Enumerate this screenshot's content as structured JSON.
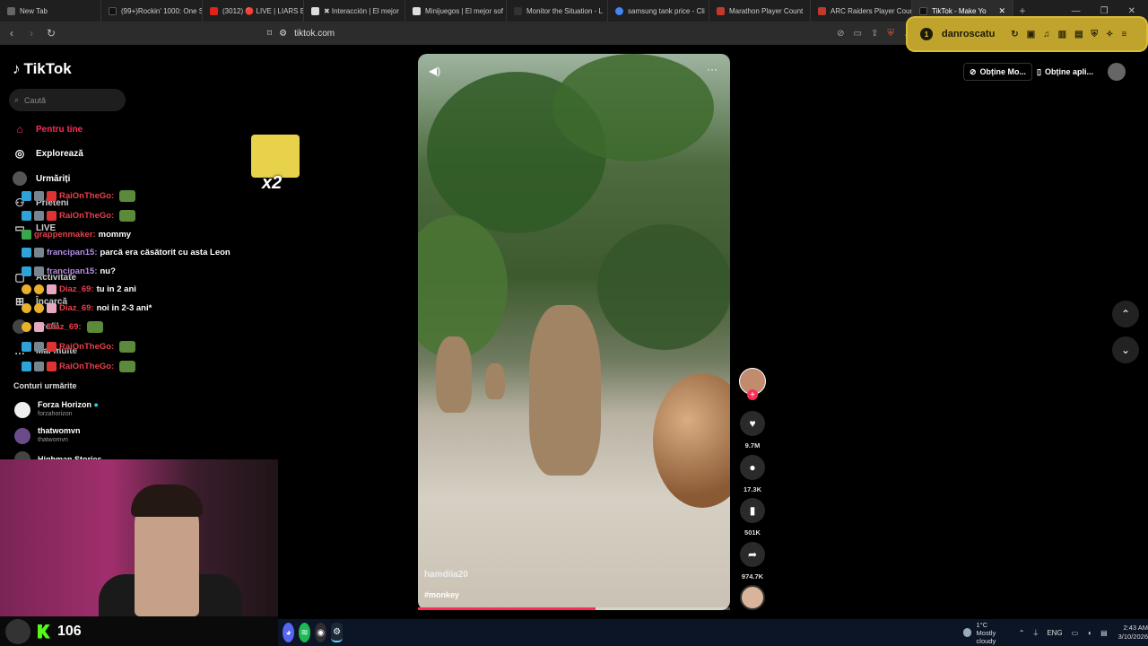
{
  "browser": {
    "tabs": [
      {
        "title": "New Tab",
        "color": "#666"
      },
      {
        "title": "(99+)Rockin' 1000: One S",
        "color": "#111"
      },
      {
        "title": "(3012) 🔴 LIVE | LIARS BA",
        "color": "#e62117"
      },
      {
        "title": "✖ Interacción | El mejor",
        "color": "#222"
      },
      {
        "title": "Minijuegos | El mejor sof",
        "color": "#222"
      },
      {
        "title": "Monitor the Situation - L",
        "color": "#333"
      },
      {
        "title": "samsung tank price - Cli",
        "color": "#4285f4"
      },
      {
        "title": "Marathon Player Count",
        "color": "#c0392b"
      },
      {
        "title": "ARC Raiders Player Coun",
        "color": "#c0392b"
      },
      {
        "title": "TikTok - Make Yo",
        "color": "#111",
        "active": true
      }
    ],
    "new_tab_label": "+",
    "url": "tiktok.com",
    "profile_name": "danroscatu",
    "profile_badge": "1"
  },
  "tiktok": {
    "logo": "TikTok",
    "search_placeholder": "Caută",
    "nav": {
      "fyp": "Pentru tine",
      "explore": "Explorează",
      "following": "Urmăriți",
      "friends": "Prieteni",
      "live": "LIVE",
      "activity": "Activitate",
      "upload": "Încarcă",
      "profile": "Profil",
      "more": "Mai multe"
    },
    "following_accounts_title": "Conturi urmărite",
    "accounts": [
      {
        "name": "Forza Horizon",
        "handle": "forzahorizon",
        "verified": true
      },
      {
        "name": "thatwomvn",
        "handle": "thatwomvn",
        "verified": false
      },
      {
        "name": "Highman.Stories",
        "handle": "",
        "verified": false
      }
    ],
    "top_buttons": {
      "get_coins": "Obține Mo...",
      "get_app": "Obține apli..."
    },
    "video": {
      "author": "hamdiia20",
      "hashtag": "#monkey",
      "progress_fraction": 0.57
    },
    "actions": {
      "likes": "9.7M",
      "comments": "17.3K",
      "saves": "501K",
      "shares": "974.7K"
    }
  },
  "chat": [
    {
      "user": "RaiOnTheGo:",
      "user_color": "#e8404a",
      "message": "",
      "emote": true
    },
    {
      "user": "RaiOnTheGo:",
      "user_color": "#e8404a",
      "message": "",
      "emote": true
    },
    {
      "user": "grappenmaker:",
      "user_color": "#e8404a",
      "message": "mommy",
      "emote": false
    },
    {
      "user": "francipan15:",
      "user_color": "#b58ee8",
      "message": "parcă era căsătorit cu asta Leon",
      "emote": false
    },
    {
      "user": "francipan15:",
      "user_color": "#b58ee8",
      "message": "nu?",
      "emote": false
    },
    {
      "user": "Diaz_69:",
      "user_color": "#e8404a",
      "message": "tu in 2 ani",
      "emote": false
    },
    {
      "user": "Diaz_69:",
      "user_color": "#e8404a",
      "message": "noi in 2-3 ani*",
      "emote": false
    },
    {
      "user": "Diaz_69:",
      "user_color": "#e8404a",
      "message": "",
      "emote": true
    },
    {
      "user": "RaiOnTheGo:",
      "user_color": "#e8404a",
      "message": "",
      "emote": true
    },
    {
      "user": "RaiOnTheGo:",
      "user_color": "#e8404a",
      "message": "",
      "emote": true
    }
  ],
  "overlay": {
    "emote_multiplier": "x2",
    "viewer_count": "106"
  },
  "taskbar": {
    "temperature": "1°C",
    "weather": "Mostly cloudy",
    "language": "ENG",
    "time": "2:43 AM",
    "date": "3/10/2026"
  }
}
